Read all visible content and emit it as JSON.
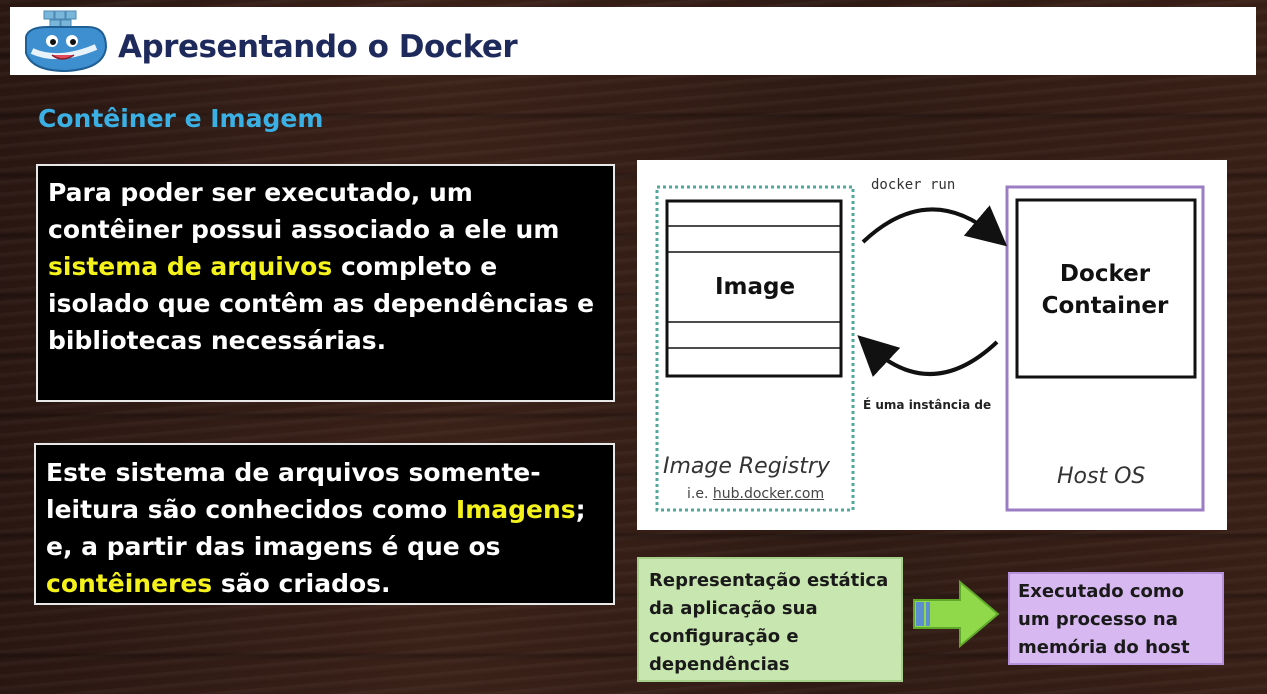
{
  "header": {
    "title": "Apresentando o Docker",
    "logo_icon": "docker-whale-icon"
  },
  "section": {
    "title": "Contêiner e Imagem"
  },
  "box1": {
    "text_before": "Para poder ser executado, um contêiner possui associado a ele um ",
    "highlight": "sistema de arquivos",
    "text_after": " completo e isolado que contêm as dependências e bibliotecas necessárias."
  },
  "box2": {
    "text_before": "Este sistema de arquivos somente-leitura são conhecidos como ",
    "highlight1": "Imagens",
    "text_middle": "; e, a partir das imagens é que os ",
    "highlight2": "contêineres",
    "text_after": " são criados."
  },
  "diagram": {
    "run_label": "docker run",
    "image_label": "Image",
    "container_label": "Docker Container",
    "instance_label": "É uma instância de",
    "registry_label": "Image Registry",
    "registry_prefix": "i.e. ",
    "registry_link": "hub.docker.com",
    "host_label": "Host OS"
  },
  "green_box": {
    "text": "Representação estática da aplicação sua configuração e dependências"
  },
  "purple_box": {
    "text": "Executado como um processo na memória do host"
  },
  "colors": {
    "header_title": "#1e2a5c",
    "section_title": "#3bb0e4",
    "highlight": "#f4f21a",
    "green_box": "#c8e6b0",
    "purple_box": "#d7b8f0",
    "registry_border": "#4fa89a",
    "host_border": "#9b7dc4"
  }
}
